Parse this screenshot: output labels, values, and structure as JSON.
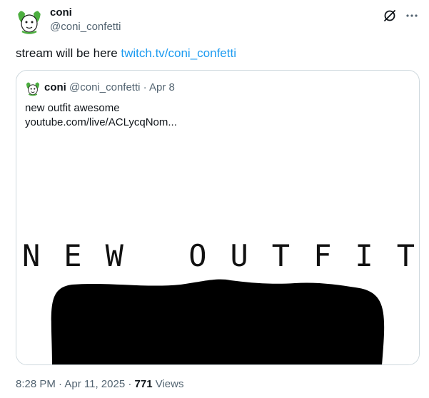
{
  "author": {
    "display_name": "coni",
    "handle": "@coni_confetti",
    "avatar_icon": "cartoon-face-avatar",
    "avatar_accent": "#4cae3f"
  },
  "actions": {
    "grok_icon": "grok-icon",
    "more_icon": "more-icon"
  },
  "tweet": {
    "text": "stream will be here ",
    "link": "twitch.tv/coni_confetti",
    "link_color": "#1d9bf0"
  },
  "quote": {
    "display_name": "coni",
    "handle": "@coni_confetti",
    "separator": " · ",
    "date": "Apr 8",
    "line1": "new outfit awesome",
    "line2": "youtube.com/live/ACLycqNom...",
    "media_text": "NEW OUTFIT"
  },
  "footer": {
    "time": "8:28 PM",
    "separator": " · ",
    "date": "Apr 11, 2025",
    "views_count": "771",
    "views_label": " Views"
  }
}
